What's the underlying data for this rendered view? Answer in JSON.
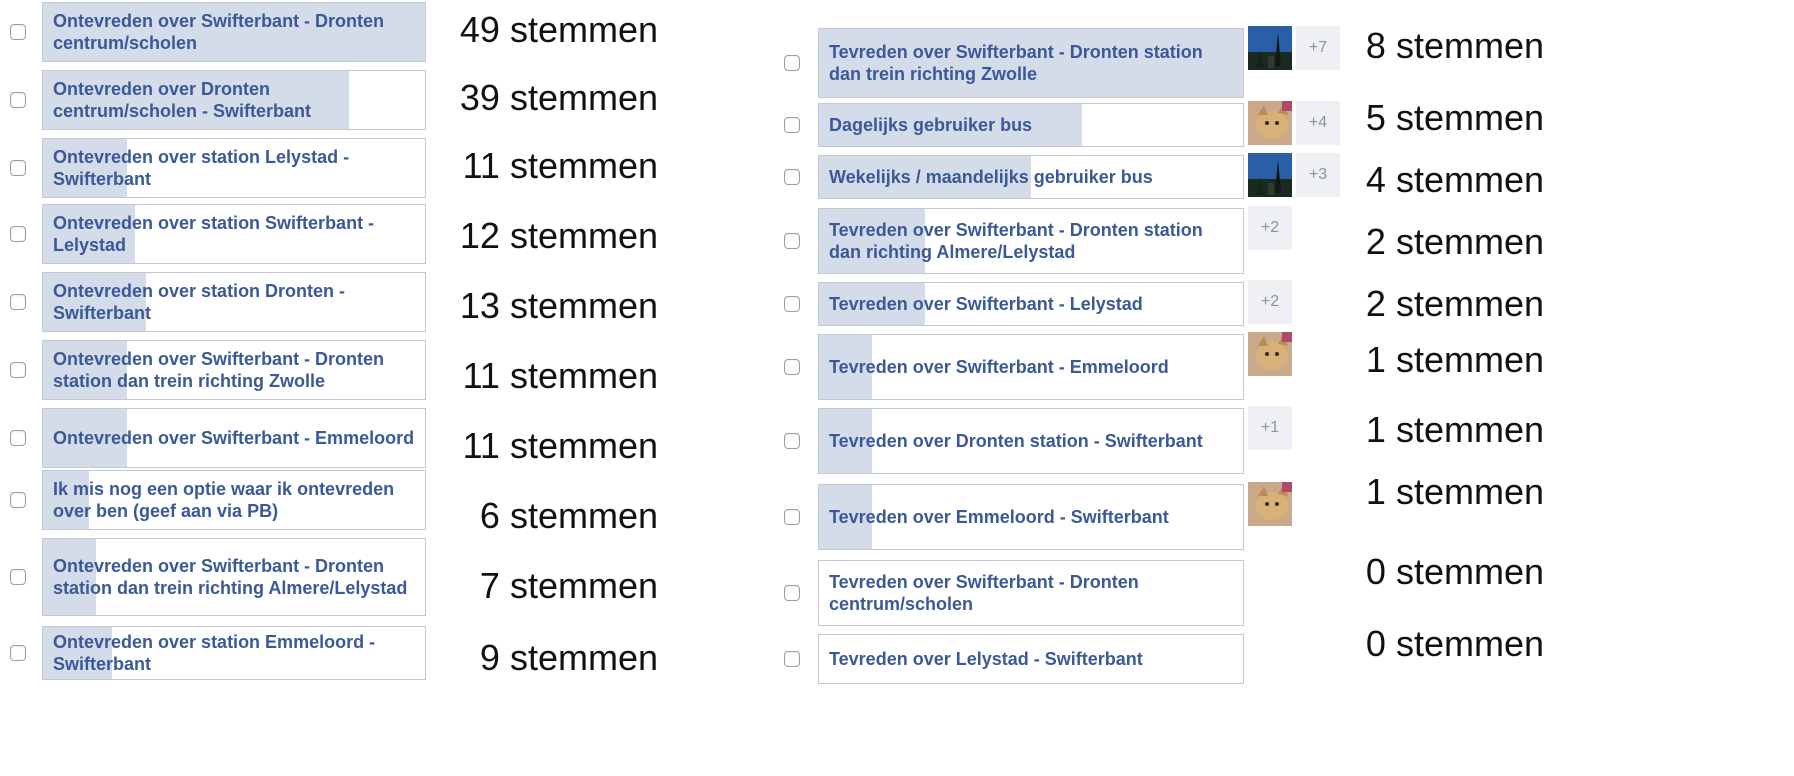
{
  "poll_left": {
    "options": [
      {
        "label": "Ontevreden over Swifterbant - Dronten centrum/scholen",
        "votes": "49 stemmen",
        "share": 1.0
      },
      {
        "label": "Ontevreden over Dronten centrum/scholen - Swifterbant",
        "votes": "39 stemmen",
        "share": 0.8
      },
      {
        "label": "Ontevreden over station Lelystad - Swifterbant",
        "votes": "11 stemmen",
        "share": 0.22
      },
      {
        "label": "Ontevreden over station Swifterbant - Lelystad",
        "votes": "12 stemmen",
        "share": 0.24
      },
      {
        "label": "Ontevreden over station Dronten - Swifterbant",
        "votes": "13 stemmen",
        "share": 0.27
      },
      {
        "label": "Ontevreden over Swifterbant - Dronten station dan trein richting Zwolle",
        "votes": "11 stemmen",
        "share": 0.22
      },
      {
        "label": "Ontevreden over Swifterbant - Emmeloord",
        "votes": "11 stemmen",
        "share": 0.22
      },
      {
        "label": "Ik mis nog een optie waar ik ontevreden over ben (geef aan via PB)",
        "votes": "6 stemmen",
        "share": 0.12
      },
      {
        "label": "Ontevreden over Swifterbant - Dronten station dan trein richting Almere/Lelystad",
        "votes": "7 stemmen",
        "share": 0.14
      },
      {
        "label": "Ontevreden over station Emmeloord - Swifterbant",
        "votes": "9 stemmen",
        "share": 0.18
      }
    ]
  },
  "poll_right": {
    "options": [
      {
        "label": "Tevreden over Swifterbant - Dronten station dan trein richting Zwolle",
        "votes": "8 stemmen",
        "share": 1.0,
        "avatar": "blue-sky-avatar",
        "more": "+7"
      },
      {
        "label": "Dagelijks gebruiker bus",
        "votes": "5 stemmen",
        "share": 0.62,
        "avatar": "cat-avatar",
        "more": "+4"
      },
      {
        "label": "Wekelijks / maandelijks gebruiker bus",
        "votes": "4 stemmen",
        "share": 0.5,
        "avatar": "blue-sky-avatar",
        "more": "+3"
      },
      {
        "label": "Tevreden over Swifterbant - Dronten station dan richting Almere/Lelystad",
        "votes": "2 stemmen",
        "share": 0.25,
        "avatar": "",
        "more": "+2"
      },
      {
        "label": "Tevreden over Swifterbant - Lelystad",
        "votes": "2 stemmen",
        "share": 0.25,
        "avatar": "",
        "more": "+2"
      },
      {
        "label": "Tevreden over Swifterbant - Emmeloord",
        "votes": "1 stemmen",
        "share": 0.125,
        "avatar": "cat-avatar",
        "more": ""
      },
      {
        "label": "Tevreden over Dronten station - Swifterbant",
        "votes": "1 stemmen",
        "share": 0.125,
        "avatar": "",
        "more": "+1"
      },
      {
        "label": "Tevreden over Emmeloord - Swifterbant",
        "votes": "1 stemmen",
        "share": 0.125,
        "avatar": "cat-avatar",
        "more": ""
      },
      {
        "label": "Tevreden over Swifterbant - Dronten centrum/scholen",
        "votes": "0 stemmen",
        "share": 0.0,
        "avatar": "",
        "more": ""
      },
      {
        "label": "Tevreden over Lelystad - Swifterbant",
        "votes": "0 stemmen",
        "share": 0.0,
        "avatar": "",
        "more": ""
      }
    ]
  }
}
